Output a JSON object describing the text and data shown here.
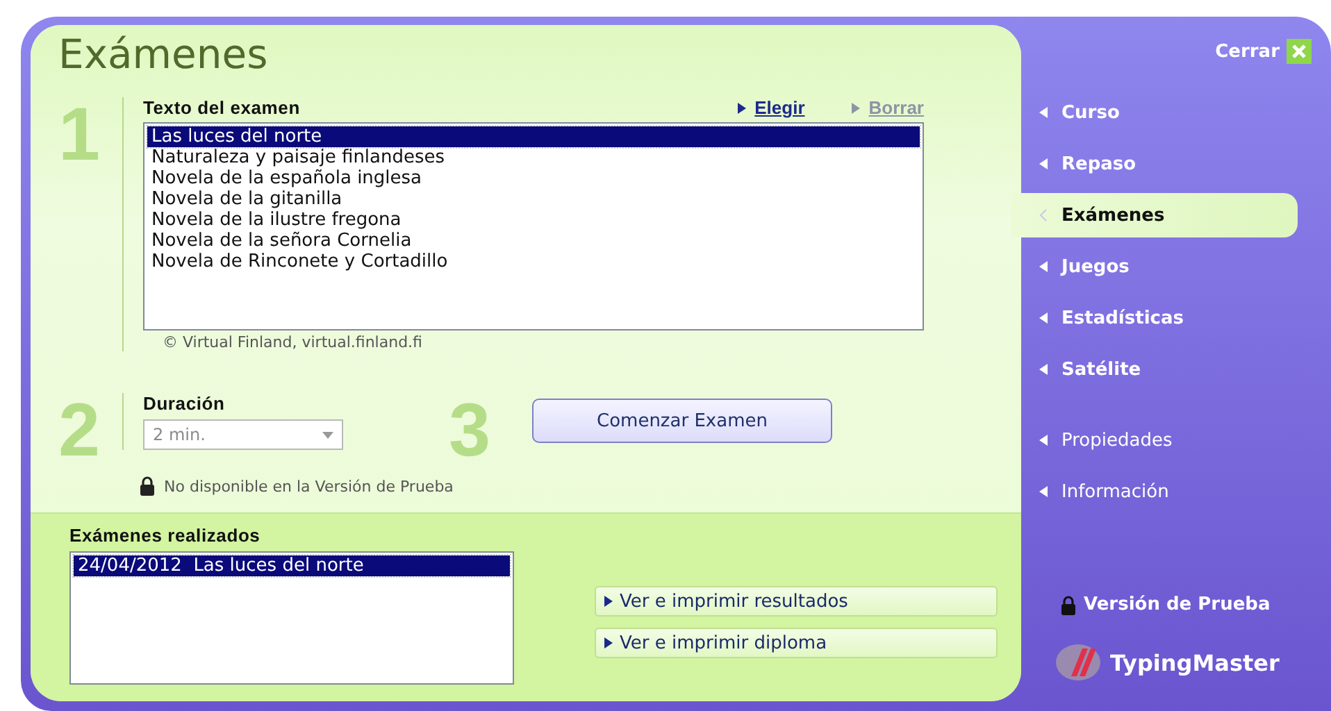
{
  "title": "Exámenes",
  "text_section": {
    "step": "1",
    "label": "Texto del examen",
    "links": [
      {
        "label": "Elegir",
        "disabled": false
      },
      {
        "label": "Borrar",
        "disabled": true
      }
    ],
    "items": [
      {
        "label": "Las luces del norte",
        "selected": true
      },
      {
        "label": "Naturaleza y paisaje finlandeses",
        "selected": false
      },
      {
        "label": "Novela de la española inglesa",
        "selected": false
      },
      {
        "label": "Novela de la gitanilla",
        "selected": false
      },
      {
        "label": "Novela de la ilustre fregona",
        "selected": false
      },
      {
        "label": "Novela de la señora Cornelia",
        "selected": false
      },
      {
        "label": "Novela de Rinconete y Cortadillo",
        "selected": false
      }
    ],
    "credit": "© Virtual Finland, virtual.finland.fi"
  },
  "duration": {
    "step": "2",
    "label": "Duración",
    "value": "2 min.",
    "disabled": true,
    "note": "No disponible en la Versión de Prueba"
  },
  "start": {
    "step": "3",
    "label": "Comenzar Examen"
  },
  "history": {
    "label": "Exámenes realizados",
    "items": [
      {
        "label": "24/04/2012  Las luces del norte",
        "selected": true
      }
    ],
    "actions": [
      "Ver e imprimir resultados",
      "Ver e imprimir diploma"
    ]
  },
  "sidebar": {
    "close": "Cerrar",
    "main_items": [
      {
        "label": "Curso",
        "selected": false
      },
      {
        "label": "Repaso",
        "selected": false
      },
      {
        "label": "Exámenes",
        "selected": true
      },
      {
        "label": "Juegos",
        "selected": false
      },
      {
        "label": "Estadísticas",
        "selected": false
      },
      {
        "label": "Satélite",
        "selected": false
      }
    ],
    "secondary_items": [
      {
        "label": "Propiedades",
        "selected": false
      },
      {
        "label": "Información",
        "selected": false
      }
    ],
    "trial": "Versión de Prueba",
    "brand": "TypingMaster"
  }
}
